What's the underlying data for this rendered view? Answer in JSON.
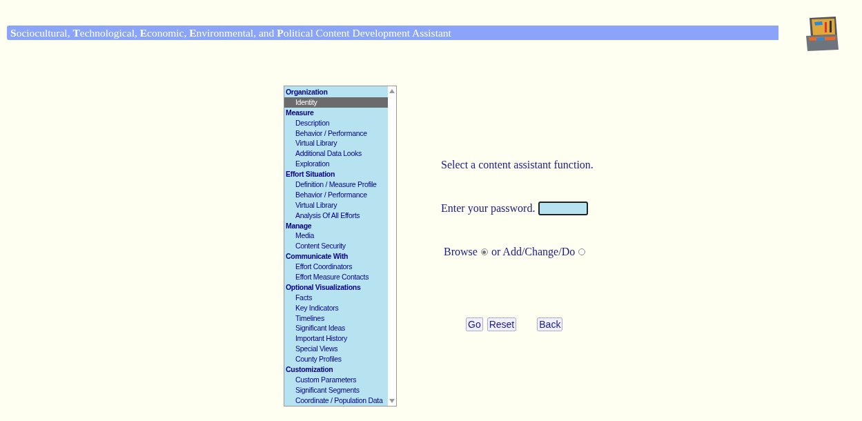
{
  "header": {
    "title": "**S**ociocultural, **T**echnological, **E**conomic, **E**nvironmental, and **P**olitical Content Development Assistant"
  },
  "menu": {
    "items": [
      {
        "label": "Organization",
        "selected": false,
        "children": [
          {
            "label": "Identity",
            "selected": true
          }
        ]
      },
      {
        "label": "Measure",
        "selected": false,
        "children": [
          {
            "label": "Description",
            "selected": false
          },
          {
            "label": "Behavior / Performance",
            "selected": false
          },
          {
            "label": "Virtual Library",
            "selected": false
          },
          {
            "label": "Additional Data Looks",
            "selected": false
          },
          {
            "label": "Exploration",
            "selected": false
          }
        ]
      },
      {
        "label": "Effort Situation",
        "selected": false,
        "children": [
          {
            "label": "Definition / Measure Profile",
            "selected": false
          },
          {
            "label": "Behavior / Performance",
            "selected": false
          },
          {
            "label": "Virtual Library",
            "selected": false
          },
          {
            "label": "Analysis Of All Efforts",
            "selected": false
          }
        ]
      },
      {
        "label": "Manage",
        "selected": false,
        "children": [
          {
            "label": "Media",
            "selected": false
          },
          {
            "label": "Content Security",
            "selected": false
          }
        ]
      },
      {
        "label": "Communicate With",
        "selected": false,
        "children": [
          {
            "label": "Effort Coordinators",
            "selected": false
          },
          {
            "label": "Effort Measure Contacts",
            "selected": false
          }
        ]
      },
      {
        "label": "Optional Visualizations",
        "selected": false,
        "children": [
          {
            "label": "Facts",
            "selected": false
          },
          {
            "label": "Key Indicators",
            "selected": false
          },
          {
            "label": "Timelines",
            "selected": false
          },
          {
            "label": "Significant Ideas",
            "selected": false
          },
          {
            "label": "Important History",
            "selected": false
          },
          {
            "label": "Special Views",
            "selected": false
          },
          {
            "label": "County Profiles",
            "selected": false
          }
        ]
      },
      {
        "label": "Customization",
        "selected": false,
        "children": [
          {
            "label": "Custom Parameters",
            "selected": false
          },
          {
            "label": "Significant Segments",
            "selected": false
          },
          {
            "label": "Coordinate / Population Data",
            "selected": false
          }
        ]
      }
    ]
  },
  "form": {
    "prompt": "Select a content assistant function.",
    "password_label": "Enter your password.",
    "modes": [
      {
        "label": "Browse",
        "selected": true
      },
      {
        "label": "or Add/Change/Do",
        "selected": false
      }
    ],
    "buttons": [
      "Go",
      "Reset",
      "Back"
    ]
  }
}
